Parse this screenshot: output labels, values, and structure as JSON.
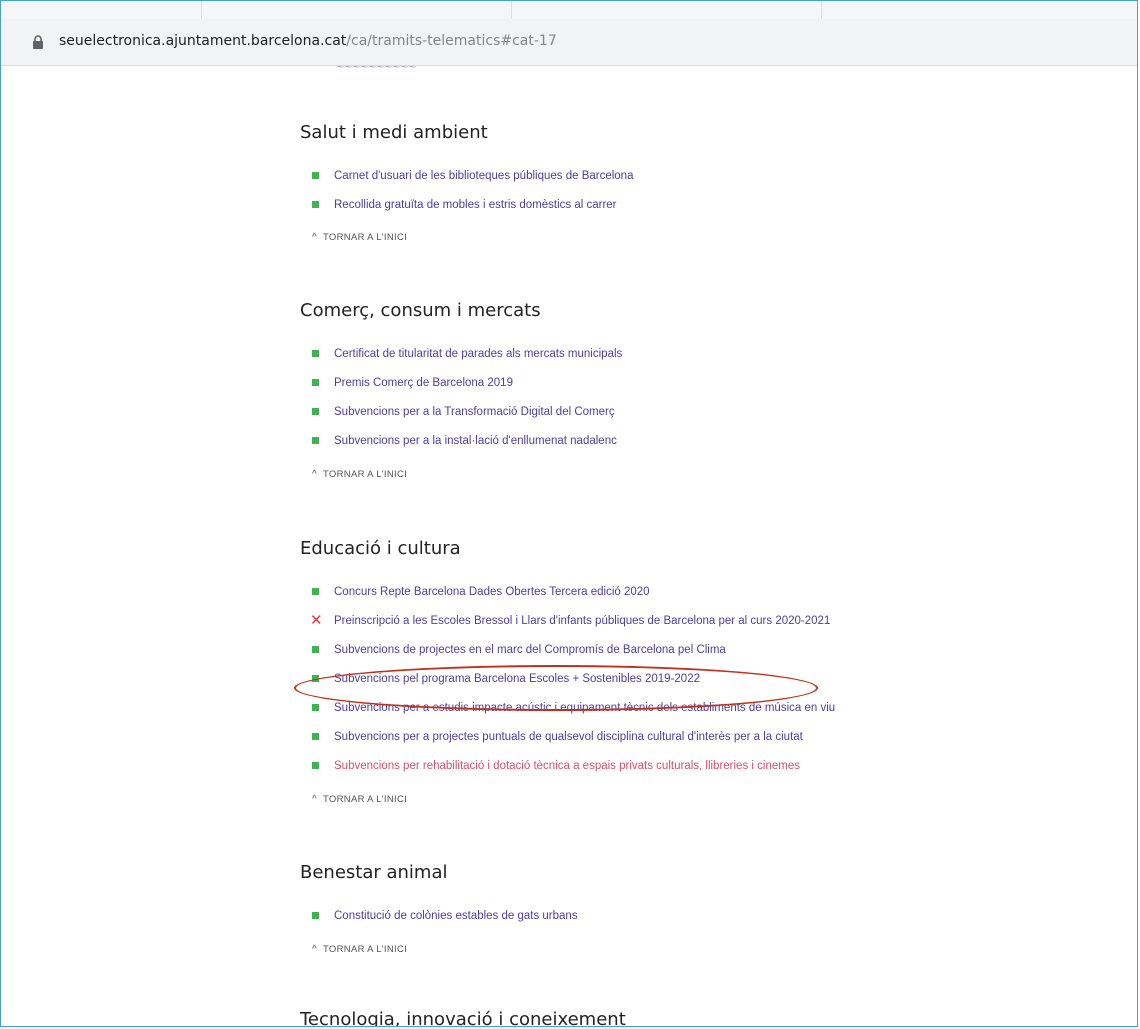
{
  "browser": {
    "url_host": "seuelectronica.ajuntament.barcelona.cat",
    "url_path": "/ca/tramits-telematics#cat-17"
  },
  "back_label": "TORNAR A L'INICI",
  "sections": [
    {
      "title": "Salut i medi ambient",
      "items": [
        {
          "label": "Carnet d'usuari de les biblioteques públiques de Barcelona",
          "status": "open"
        },
        {
          "label": "Recollida gratuïta de mobles i estris domèstics al carrer",
          "status": "open"
        }
      ]
    },
    {
      "title": "Comerç, consum i mercats",
      "items": [
        {
          "label": "Certificat de titularitat de parades als mercats municipals",
          "status": "open"
        },
        {
          "label": "Premis Comerç de Barcelona 2019",
          "status": "open"
        },
        {
          "label": "Subvencions per a la Transformació Digital del Comerç",
          "status": "open"
        },
        {
          "label": "Subvencions per a la instal·lació d'enllumenat nadalenc",
          "status": "open"
        }
      ]
    },
    {
      "title": "Educació i cultura",
      "items": [
        {
          "label": "Concurs Repte Barcelona Dades Obertes Tercera edició 2020",
          "status": "open"
        },
        {
          "label": "Preinscripció a les Escoles Bressol i Llars d'infants públiques de Barcelona per al curs 2020-2021",
          "status": "closed"
        },
        {
          "label": "Subvencions de projectes en el marc del Compromís de Barcelona pel Clima",
          "status": "open"
        },
        {
          "label": "Subvencions pel programa Barcelona Escoles + Sostenibles 2019-2022",
          "status": "open",
          "highlighted": true
        },
        {
          "label": "Subvencions per a estudis impacte acústic i equipament tècnic dels establiments de música en viu",
          "status": "open"
        },
        {
          "label": "Subvencions per a projectes puntuals de qualsevol disciplina cultural d'interès per a la ciutat",
          "status": "open"
        },
        {
          "label": "Subvencions per rehabilitació i dotació tècnica a espais privats culturals, llibreries i cinemes",
          "status": "open",
          "color": "#d94f6a"
        }
      ]
    },
    {
      "title": "Benestar animal",
      "items": [
        {
          "label": "Constitució de colònies estables de gats urbans",
          "status": "open"
        }
      ]
    }
  ],
  "next_section_title": "Tecnologia, innovació i coneixement",
  "colors": {
    "bullet_open": "#3fb34f",
    "bullet_closed": "#e53935",
    "link": "#4b3f9e",
    "highlight_oval": "#c0311b"
  }
}
